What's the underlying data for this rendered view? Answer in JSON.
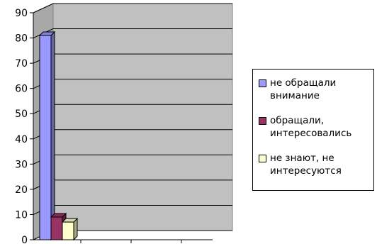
{
  "chart_data": {
    "type": "bar",
    "title": "",
    "xlabel": "",
    "ylabel": "",
    "ylim": [
      0,
      90
    ],
    "yticks": [
      0,
      10,
      20,
      30,
      40,
      50,
      60,
      70,
      80,
      90
    ],
    "grid": true,
    "bar3d": true,
    "legend_position": "right",
    "series": [
      {
        "name": "не обращали\nвнимание",
        "value": 81,
        "color": "#9999ff"
      },
      {
        "name": "обращали,\nинтересовались",
        "value": 9,
        "color": "#993366"
      },
      {
        "name": "не знают, не\nинтересуются",
        "value": 7,
        "color": "#ffffcc"
      }
    ],
    "plot_background": "#c0c0c0"
  }
}
